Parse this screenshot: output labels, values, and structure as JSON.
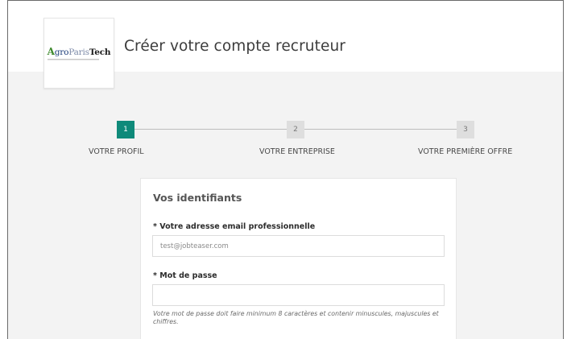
{
  "header": {
    "logo": {
      "text_a": "A",
      "text_gro": "gro",
      "text_paris": "Paris",
      "text_tech": "Tech"
    },
    "title": "Créer votre compte recruteur"
  },
  "stepper": {
    "steps": [
      {
        "number": "1",
        "label": "VOTRE PROFIL",
        "active": true
      },
      {
        "number": "2",
        "label": "VOTRE ENTREPRISE",
        "active": false
      },
      {
        "number": "3",
        "label": "VOTRE PREMIÈRE OFFRE",
        "active": false
      }
    ]
  },
  "form": {
    "section_title": "Vos identifiants",
    "email": {
      "label": "* Votre adresse email professionnelle",
      "value": "test@jobteaser.com"
    },
    "password": {
      "label": "* Mot de passe",
      "value": ""
    },
    "password_hint": "Votre mot de passe doit faire minimum 8 caractères et contenir minuscules, majuscules et chiffres."
  },
  "colors": {
    "accent": "#0f8a7a",
    "inactive_step": "#dedede",
    "background": "#f3f3f3"
  }
}
